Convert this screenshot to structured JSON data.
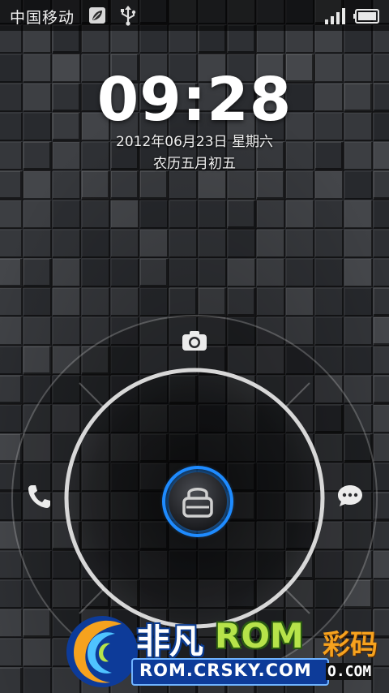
{
  "status_bar": {
    "carrier": "中国移动",
    "icons": [
      "leaf-notification-icon",
      "usb-icon",
      "signal-icon",
      "battery-icon"
    ]
  },
  "lockscreen": {
    "time": "09:28",
    "date": "2012年06月23日 星期六",
    "lunar_date": "农历五月初五",
    "shortcuts": [
      "camera-icon",
      "phone-icon",
      "message-icon"
    ],
    "handle_icon": "lock-icon",
    "accent_color": "#1e8bff"
  },
  "watermark": {
    "brand_cn": "非凡",
    "brand_rom": "ROM",
    "brand_side": "彩码",
    "url": "ROM.CRSKY.COM",
    "url_tail": "O.COM"
  }
}
